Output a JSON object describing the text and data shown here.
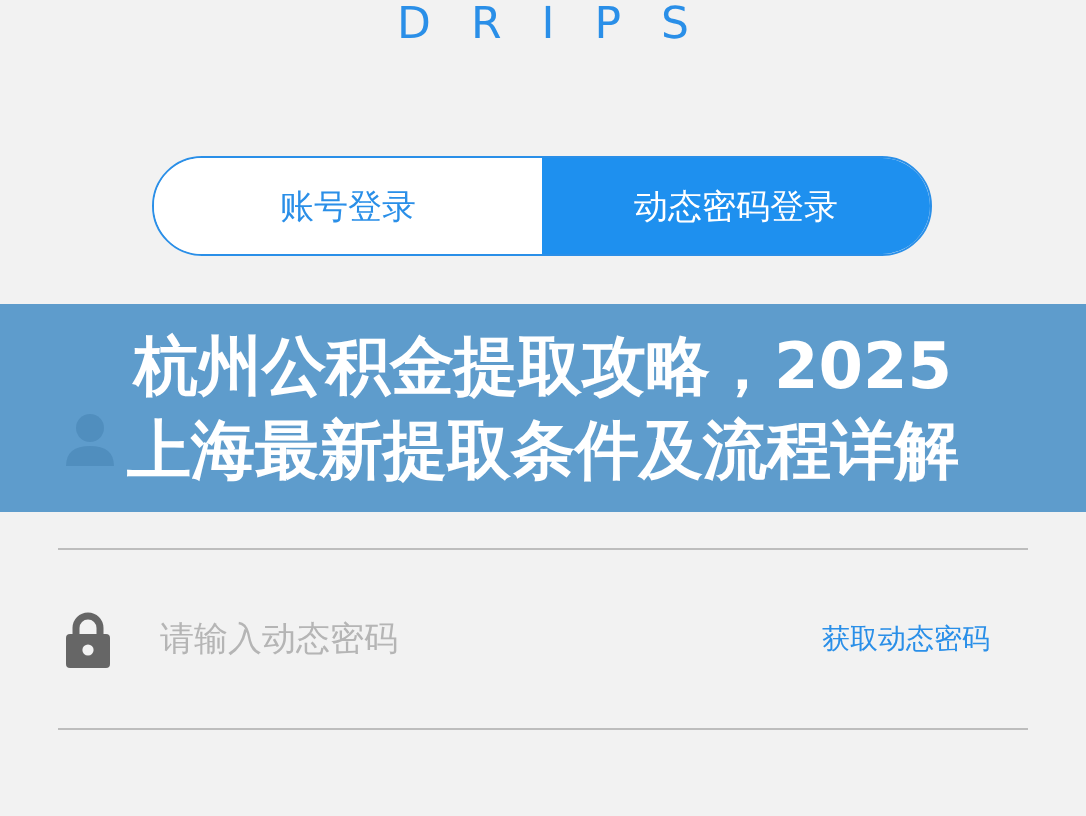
{
  "logo": "DRIPS",
  "tabs": [
    {
      "label": "账号登录",
      "selected": false
    },
    {
      "label": "动态密码登录",
      "selected": true
    }
  ],
  "password_field": {
    "placeholder": "请输入动态密码",
    "action": "获取动态密码"
  },
  "banner": {
    "title_lines": [
      "杭州公积金提取攻略，2025",
      "上海最新提取条件及流程详解"
    ]
  }
}
